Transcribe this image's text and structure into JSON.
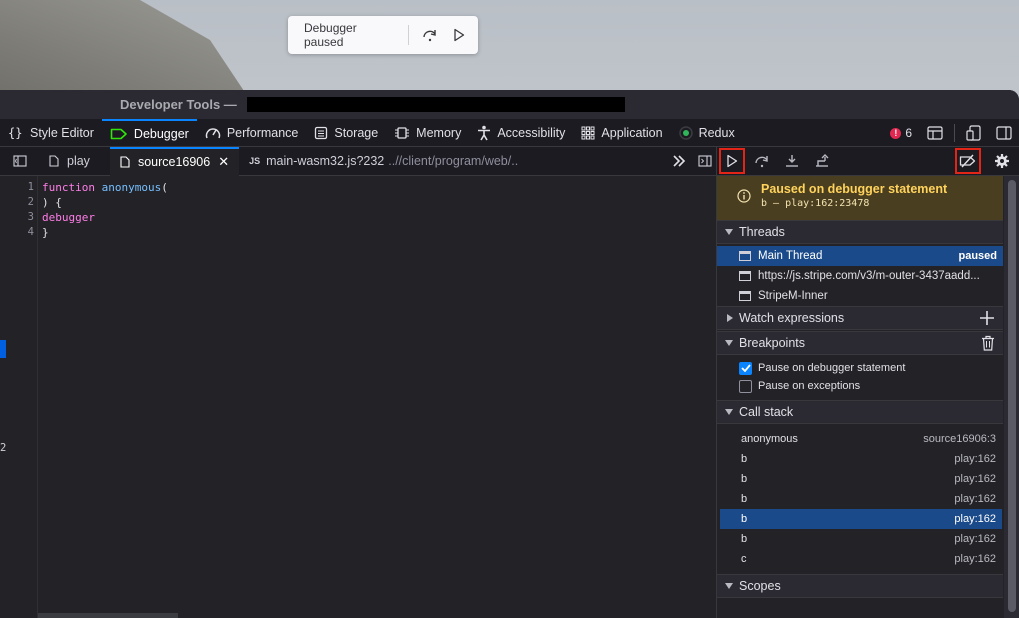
{
  "overlay": {
    "paused_label": "Debugger paused",
    "step_over_icon": "step-over-icon",
    "resume_icon": "resume-icon"
  },
  "window": {
    "title": "Developer Tools —"
  },
  "toolbar": {
    "tabs": [
      {
        "icon": "braces-icon",
        "label": "Style Editor"
      },
      {
        "icon": "debugger-icon",
        "label": "Debugger"
      },
      {
        "icon": "gauge-icon",
        "label": "Performance"
      },
      {
        "icon": "storage-icon",
        "label": "Storage"
      },
      {
        "icon": "chip-icon",
        "label": "Memory"
      },
      {
        "icon": "person-icon",
        "label": "Accessibility"
      },
      {
        "icon": "grid-icon",
        "label": "Application"
      },
      {
        "icon": "redux-icon",
        "label": "Redux"
      }
    ],
    "active_tab": "Debugger",
    "error_count": "6"
  },
  "sources": {
    "tabs": [
      {
        "label": "play",
        "path": ""
      },
      {
        "label": "source16906",
        "path": "",
        "close": "✕"
      },
      {
        "label": "main-wasm32.js?232",
        "path": "..//client/program/web/..",
        "badge": "JS"
      }
    ]
  },
  "editor": {
    "line_numbers": [
      "1",
      "2",
      "3",
      "4"
    ],
    "lines": [
      {
        "kw": "function",
        "fn": "anonymous",
        "rest": "("
      },
      {
        "kw": "",
        "fn": "",
        "rest": ") {"
      },
      {
        "kw": "debugger",
        "fn": "",
        "rest": ""
      },
      {
        "kw": "",
        "fn": "",
        "rest": "}"
      }
    ],
    "stray_line_number": "2"
  },
  "pause": {
    "title": "Paused on debugger statement",
    "location": "b – play:162:23478"
  },
  "threads": {
    "header": "Threads",
    "items": [
      {
        "label": "Main Thread",
        "state": "paused"
      },
      {
        "label": "https://js.stripe.com/v3/m-outer-3437aadd...",
        "state": ""
      },
      {
        "label": "StripeM-Inner",
        "state": ""
      }
    ]
  },
  "watch": {
    "header": "Watch expressions"
  },
  "breakpoints": {
    "header": "Breakpoints",
    "options": [
      {
        "label": "Pause on debugger statement",
        "checked": true
      },
      {
        "label": "Pause on exceptions",
        "checked": false
      }
    ]
  },
  "callstack": {
    "header": "Call stack",
    "frames": [
      {
        "name": "anonymous",
        "location": "source16906:3"
      },
      {
        "name": "b",
        "location": "play:162"
      },
      {
        "name": "b",
        "location": "play:162"
      },
      {
        "name": "b",
        "location": "play:162"
      },
      {
        "name": "b",
        "location": "play:162"
      },
      {
        "name": "b",
        "location": "play:162"
      },
      {
        "name": "c",
        "location": "play:162"
      }
    ],
    "selected_index": 4
  },
  "scopes": {
    "header": "Scopes"
  },
  "colors": {
    "accent": "#0a84ff",
    "highlight_box": "#e22516",
    "pause_banner_bg": "#4a3e20",
    "pause_banner_text": "#ffd35c",
    "keyword": "#ff7de9",
    "function_name": "#75bfff"
  }
}
